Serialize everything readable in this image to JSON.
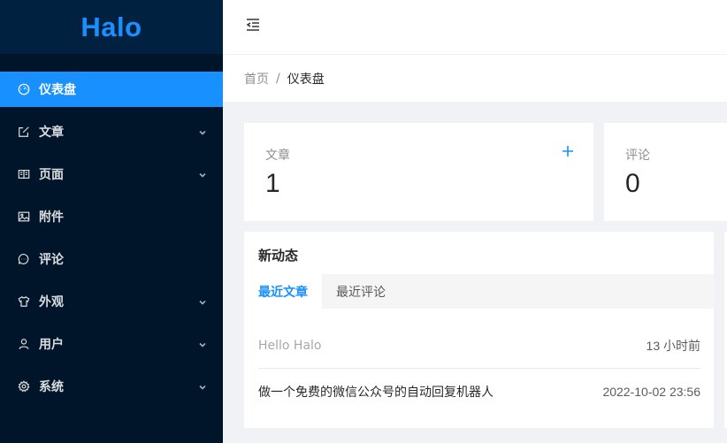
{
  "app": {
    "logo": "Halo"
  },
  "sidebar": {
    "items": [
      {
        "label": "仪表盘",
        "icon": "dashboard-icon",
        "active": true
      },
      {
        "label": "文章",
        "icon": "edit-icon",
        "expandable": true
      },
      {
        "label": "页面",
        "icon": "book-icon",
        "expandable": true
      },
      {
        "label": "附件",
        "icon": "picture-icon"
      },
      {
        "label": "评论",
        "icon": "message-icon"
      },
      {
        "label": "外观",
        "icon": "skin-icon",
        "expandable": true
      },
      {
        "label": "用户",
        "icon": "user-icon",
        "expandable": true
      },
      {
        "label": "系统",
        "icon": "setting-icon",
        "expandable": true
      }
    ]
  },
  "header": {
    "trigger_icon": "menu-fold-icon"
  },
  "breadcrumb": {
    "home": "首页",
    "separator": "/",
    "current": "仪表盘"
  },
  "stats": {
    "posts": {
      "title": "文章",
      "value": "1",
      "action_icon": "plus-icon"
    },
    "comments": {
      "title": "评论",
      "value": "0"
    }
  },
  "activity": {
    "title": "新动态",
    "tabs": [
      {
        "label": "最近文章",
        "active": true
      },
      {
        "label": "最近评论",
        "active": false
      }
    ],
    "rows": [
      {
        "title": "Hello Halo",
        "time": "13 小时前"
      },
      {
        "title": "做一个免费的微信公众号的自动回复机器人",
        "time": "2022-10-02 23:56"
      }
    ]
  },
  "colors": {
    "sidebar_bg": "#001529",
    "accent": "#1890ff",
    "page_bg": "#f0f2f5"
  }
}
